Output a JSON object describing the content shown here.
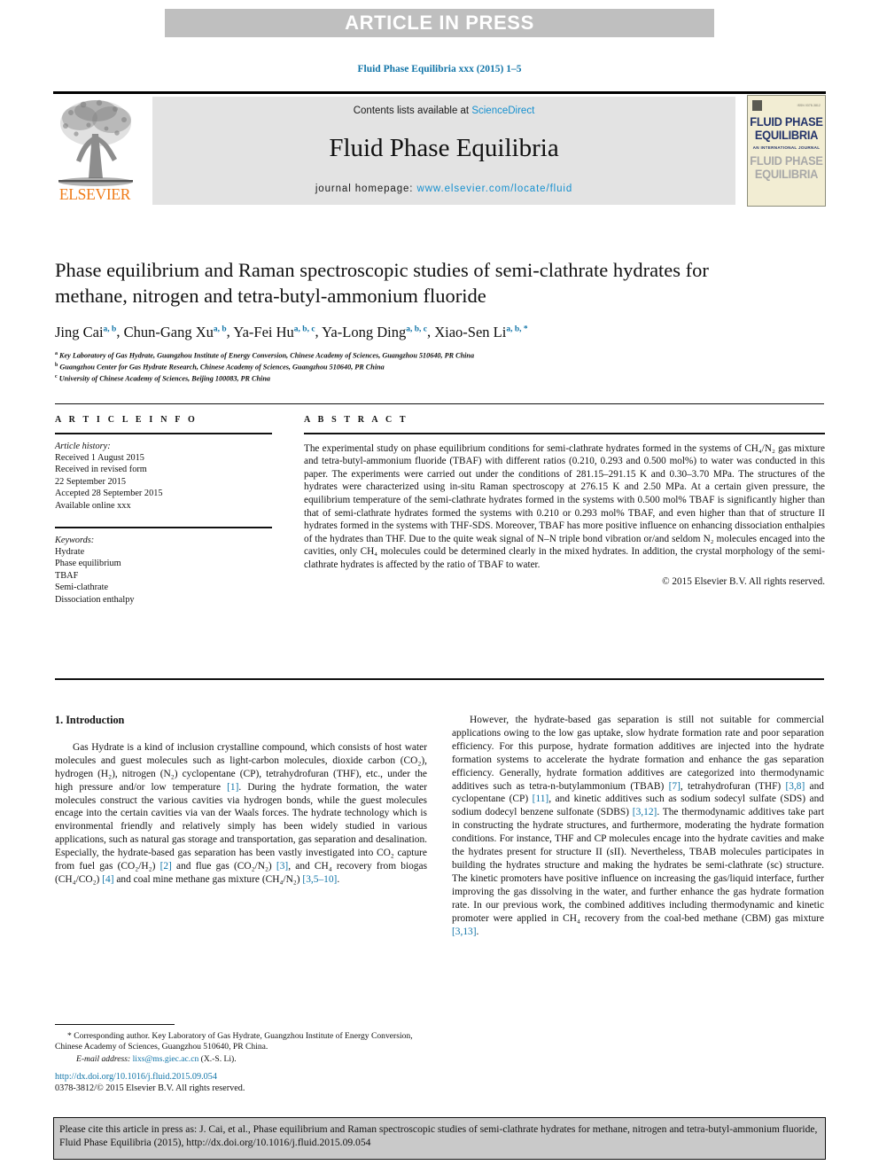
{
  "banner": {
    "article_in_press": "ARTICLE IN PRESS"
  },
  "running_head": "Fluid Phase Equilibria xxx (2015) 1–5",
  "masthead": {
    "contents_prefix": "Contents lists available at ",
    "sciencedirect_link": "ScienceDirect",
    "journal_name": "Fluid Phase Equilibria",
    "homepage_prefix": "journal homepage: ",
    "homepage_url": "www.elsevier.com/locate/fluid",
    "publisher_logo_text": "ELSEVIER",
    "cover": {
      "tiny_top_right": "ISSN 0378-3812",
      "title_line1": "FLUID PHASE",
      "title_line2": "EQUILIBRIA",
      "subtitle": "AN INTERNATIONAL JOURNAL",
      "ghost_line1": "FLUID PHASE",
      "ghost_line2": "EQUILIBRIA"
    }
  },
  "article": {
    "title": "Phase equilibrium and Raman spectroscopic studies of semi-clathrate hydrates for methane, nitrogen and tetra-butyl-ammonium fluoride",
    "authors": [
      {
        "name": "Jing Cai",
        "sup": "a, b"
      },
      {
        "name": "Chun-Gang Xu",
        "sup": "a, b"
      },
      {
        "name": "Ya-Fei Hu",
        "sup": "a, b, c"
      },
      {
        "name": "Ya-Long Ding",
        "sup": "a, b, c"
      },
      {
        "name": "Xiao-Sen Li",
        "sup": "a, b, *"
      }
    ],
    "affiliations": [
      {
        "marker": "a",
        "text": "Key Laboratory of Gas Hydrate, Guangzhou Institute of Energy Conversion, Chinese Academy of Sciences, Guangzhou 510640, PR China"
      },
      {
        "marker": "b",
        "text": "Guangzhou Center for Gas Hydrate Research, Chinese Academy of Sciences, Guangzhou 510640, PR China"
      },
      {
        "marker": "c",
        "text": "University of Chinese Academy of Sciences, Beijing 100083, PR China"
      }
    ]
  },
  "article_info": {
    "heading": "A R T I C L E   I N F O",
    "history_label": "Article history:",
    "history_lines": [
      "Received 1 August 2015",
      "Received in revised form",
      "22 September 2015",
      "Accepted 28 September 2015",
      "Available online xxx"
    ],
    "keywords_label": "Keywords:",
    "keywords": [
      "Hydrate",
      "Phase equilibrium",
      "TBAF",
      "Semi-clathrate",
      "Dissociation enthalpy"
    ]
  },
  "abstract": {
    "heading": "A B S T R A C T",
    "text": "The experimental study on phase equilibrium conditions for semi-clathrate hydrates formed in the systems of CH₄/N₂ gas mixture and tetra-butyl-ammonium fluoride (TBAF) with different ratios (0.210, 0.293 and 0.500 mol%) to water was conducted in this paper. The experiments were carried out under the conditions of 281.15–291.15 K and 0.30–3.70 MPa. The structures of the hydrates were characterized using in-situ Raman spectroscopy at 276.15 K and 2.50 MPa. At a certain given pressure, the equilibrium temperature of the semi-clathrate hydrates formed in the systems with 0.500 mol% TBAF is significantly higher than that of semi-clathrate hydrates formed the systems with 0.210 or 0.293 mol% TBAF, and even higher than that of structure II hydrates formed in the systems with THF-SDS. Moreover, TBAF has more positive influence on enhancing dissociation enthalpies of the hydrates than THF. Due to the quite weak signal of N–N triple bond vibration or/and seldom N₂ molecules encaged into the cavities, only CH₄ molecules could be determined clearly in the mixed hydrates. In addition, the crystal morphology of the semi-clathrate hydrates is affected by the ratio of TBAF to water.",
    "copyright": "© 2015 Elsevier B.V. All rights reserved."
  },
  "introduction": {
    "heading": "1. Introduction",
    "left_paragraph_1": "Gas Hydrate is a kind of inclusion crystalline compound, which consists of host water molecules and guest molecules such as light-carbon molecules, dioxide carbon (CO₂), hydrogen (H₂), nitrogen (N₂) cyclopentane (CP), tetrahydrofuran (THF), etc., under the high pressure and/or low temperature",
    "left_ref_1": "[1]",
    "left_paragraph_1b": ". During the hydrate formation, the water molecules construct the various cavities via hydrogen bonds, while the guest molecules encage into the certain cavities via van der Waals forces. The hydrate technology which is environmental friendly and relatively simply has been widely studied in various applications, such as natural gas storage and transportation, gas separation and desalination. Especially, the hydrate-based gas separation has been vastly investigated into CO₂ capture from fuel gas (CO₂/H₂) ",
    "left_ref_2": "[2]",
    "left_paragraph_1c": " and flue gas (CO₂/N₂) ",
    "left_ref_3": "[3]",
    "left_paragraph_1d": ", and CH₄ recovery from biogas (CH₄/CO₂) ",
    "left_ref_4": "[4]",
    "left_paragraph_1e": " and coal mine methane gas mixture (CH₄/N₂) ",
    "left_ref_5": "[3,5–10]",
    "left_paragraph_1f": ".",
    "right_paragraph_1": "However, the hydrate-based gas separation is still not suitable for commercial applications owing to the low gas uptake, slow hydrate formation rate and poor separation efficiency. For this purpose, hydrate formation additives are injected into the hydrate formation systems to accelerate the hydrate formation and enhance the gas separation efficiency. Generally, hydrate formation additives are categorized into thermodynamic additives such as tetra-n-butylammonium (TBAB) ",
    "right_ref_1": "[7]",
    "right_paragraph_1b": ", tetrahydrofuran (THF) ",
    "right_ref_2": "[3,8]",
    "right_paragraph_1c": " and cyclopentane (CP) ",
    "right_ref_3": "[11]",
    "right_paragraph_1d": ", and kinetic additives such as sodium sodecyl sulfate (SDS) and sodium dodecyl benzene sulfonate (SDBS) ",
    "right_ref_4": "[3,12]",
    "right_paragraph_1e": ". The thermodynamic additives take part in constructing the hydrate structures, and furthermore, moderating the hydrate formation conditions. For instance, THF and CP molecules encage into the hydrate cavities and make the hydrates present for structure II (sII). Nevertheless, TBAB molecules participates in building the hydrates structure and making the hydrates be semi-clathrate (sc) structure. The kinetic promoters have positive influence on increasing the gas/liquid interface, further improving the gas dissolving in the water, and further enhance the gas hydrate formation rate. In our previous work, the combined additives including thermodynamic and kinetic promoter were applied in CH₄ recovery from the coal-bed methane (CBM) gas mixture ",
    "right_ref_5": "[3,13]",
    "right_paragraph_1f": "."
  },
  "footnote": {
    "star_marker": "*",
    "corresponding": "Corresponding author. Key Laboratory of Gas Hydrate, Guangzhou Institute of Energy Conversion, Chinese Academy of Sciences, Guangzhou 510640, PR China.",
    "email_label": "E-mail address:",
    "email": "lixs@ms.giec.ac.cn",
    "email_owner": "(X.-S. Li).",
    "doi_url": "http://dx.doi.org/10.1016/j.fluid.2015.09.054",
    "issn_line": "0378-3812/© 2015 Elsevier B.V. All rights reserved."
  },
  "citation_box": {
    "text": "Please cite this article in press as: J. Cai, et al., Phase equilibrium and Raman spectroscopic studies of semi-clathrate hydrates for methane, nitrogen and tetra-butyl-ammonium fluoride, Fluid Phase Equilibria (2015), http://dx.doi.org/10.1016/j.fluid.2015.09.054"
  },
  "colors": {
    "link_blue": "#1275a8",
    "sciencedirect_blue": "#1690cf",
    "elsevier_orange": "#f07c19",
    "banner_gray": "#bfbfbf",
    "masthead_gray": "#e3e3e3",
    "cite_box_gray": "#c9c9c9",
    "cover_cream": "#f2edd3",
    "cover_navy": "#24346b"
  }
}
